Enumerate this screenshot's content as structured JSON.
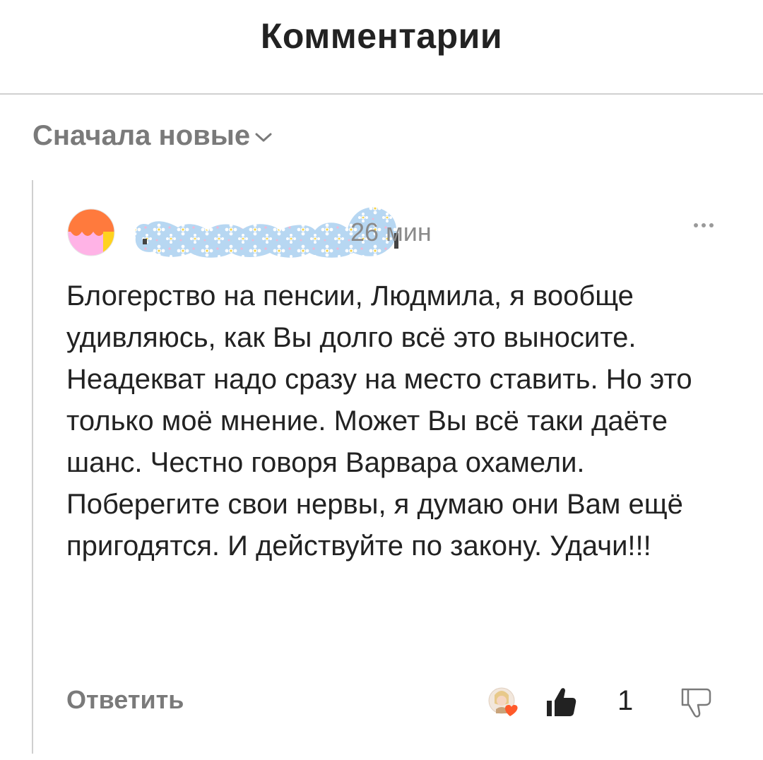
{
  "header": {
    "title": "Комментарии"
  },
  "sort": {
    "label": "Сначала новые",
    "icon": "chevron-down-icon"
  },
  "comment": {
    "time": "26 мин",
    "text": "Блогерство на пенсии, Людмила, я вообще удивляюсь, как Вы долго всё это выносите. Неадекват надо сразу на место ставить. Но это только моё мнение. Может Вы всё таки даёте шанс. Честно говоря Варвара охамели. Поберегите свои нервы, я думаю они Вам ещё пригодятся. И действуйте по закону. Удачи!!!",
    "reply_label": "Ответить",
    "likes": "1"
  },
  "colors": {
    "primary_text": "#222222",
    "secondary_text": "#7a7a7a",
    "divider": "#d0d0d0",
    "avatar_orange": "#ff7a3d",
    "avatar_pink": "#ffb3e6",
    "avatar_yellow": "#ffd21f",
    "reaction_heart": "#ff5a2a"
  }
}
